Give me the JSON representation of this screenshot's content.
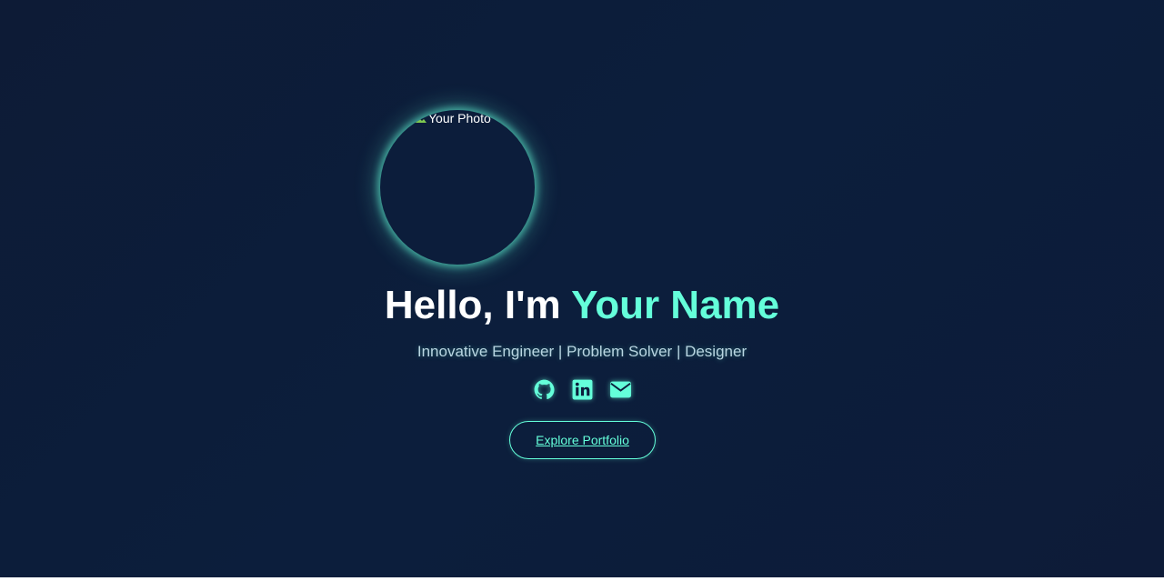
{
  "hero": {
    "photo_alt": "Your Photo",
    "greeting": "Hello, I'm ",
    "name": "Your Name",
    "tagline": "Innovative Engineer | Problem Solver | Designer",
    "cta_label": "Explore Portfolio"
  },
  "socials": [
    {
      "icon": "github-icon"
    },
    {
      "icon": "linkedin-icon"
    },
    {
      "icon": "envelope-icon"
    }
  ],
  "colors": {
    "accent": "#64ffda",
    "background": "#0d1b36",
    "tagline": "#b9d6e2",
    "text": "#ffffff"
  }
}
